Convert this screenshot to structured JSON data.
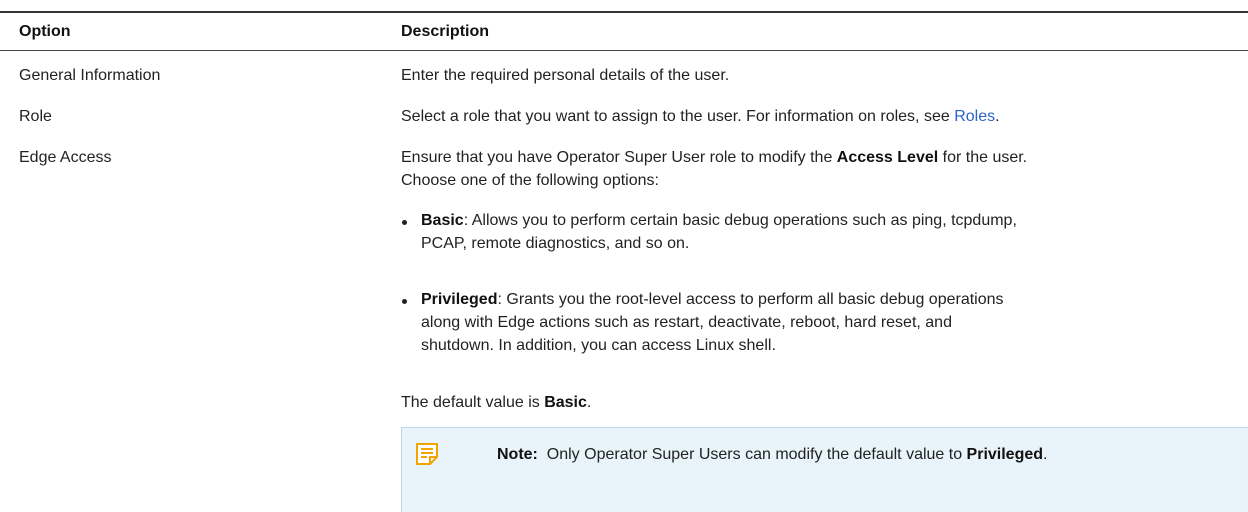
{
  "table": {
    "headers": {
      "option": "Option",
      "description": "Description"
    },
    "rows": [
      {
        "option": "General Information",
        "description": "Enter the required personal details of the user."
      },
      {
        "option": "Role",
        "description_prefix": "Select a role that you want to assign to the user. For information on roles, see ",
        "description_link": "Roles",
        "description_suffix": "."
      },
      {
        "option": "Edge Access",
        "intro": {
          "part1": "Ensure that you have Operator Super User role to modify the ",
          "bold": "Access Level",
          "part2": " for the user.",
          "line2": "Choose one of the following options:"
        },
        "options": [
          {
            "term": "Basic",
            "line1": ": Allows you to perform certain basic debug operations such as ping, tcpdump,",
            "line2": "PCAP, remote diagnostics, and so on."
          },
          {
            "term": "Privileged",
            "line1": ": Grants you the root-level access to perform all basic debug operations",
            "line2": "along with Edge actions such as restart, deactivate, reboot, hard reset, and",
            "line3": "shutdown. In addition, you can access Linux shell."
          }
        ],
        "default": {
          "prefix": "The default value is ",
          "value": "Basic",
          "suffix": "."
        },
        "note": {
          "label": "Note:",
          "text": "  Only Operator Super Users can modify the default value to ",
          "value": "Privileged",
          "suffix": ".",
          "icon": "note-icon",
          "icon_color": "#f0a500"
        }
      }
    ]
  }
}
